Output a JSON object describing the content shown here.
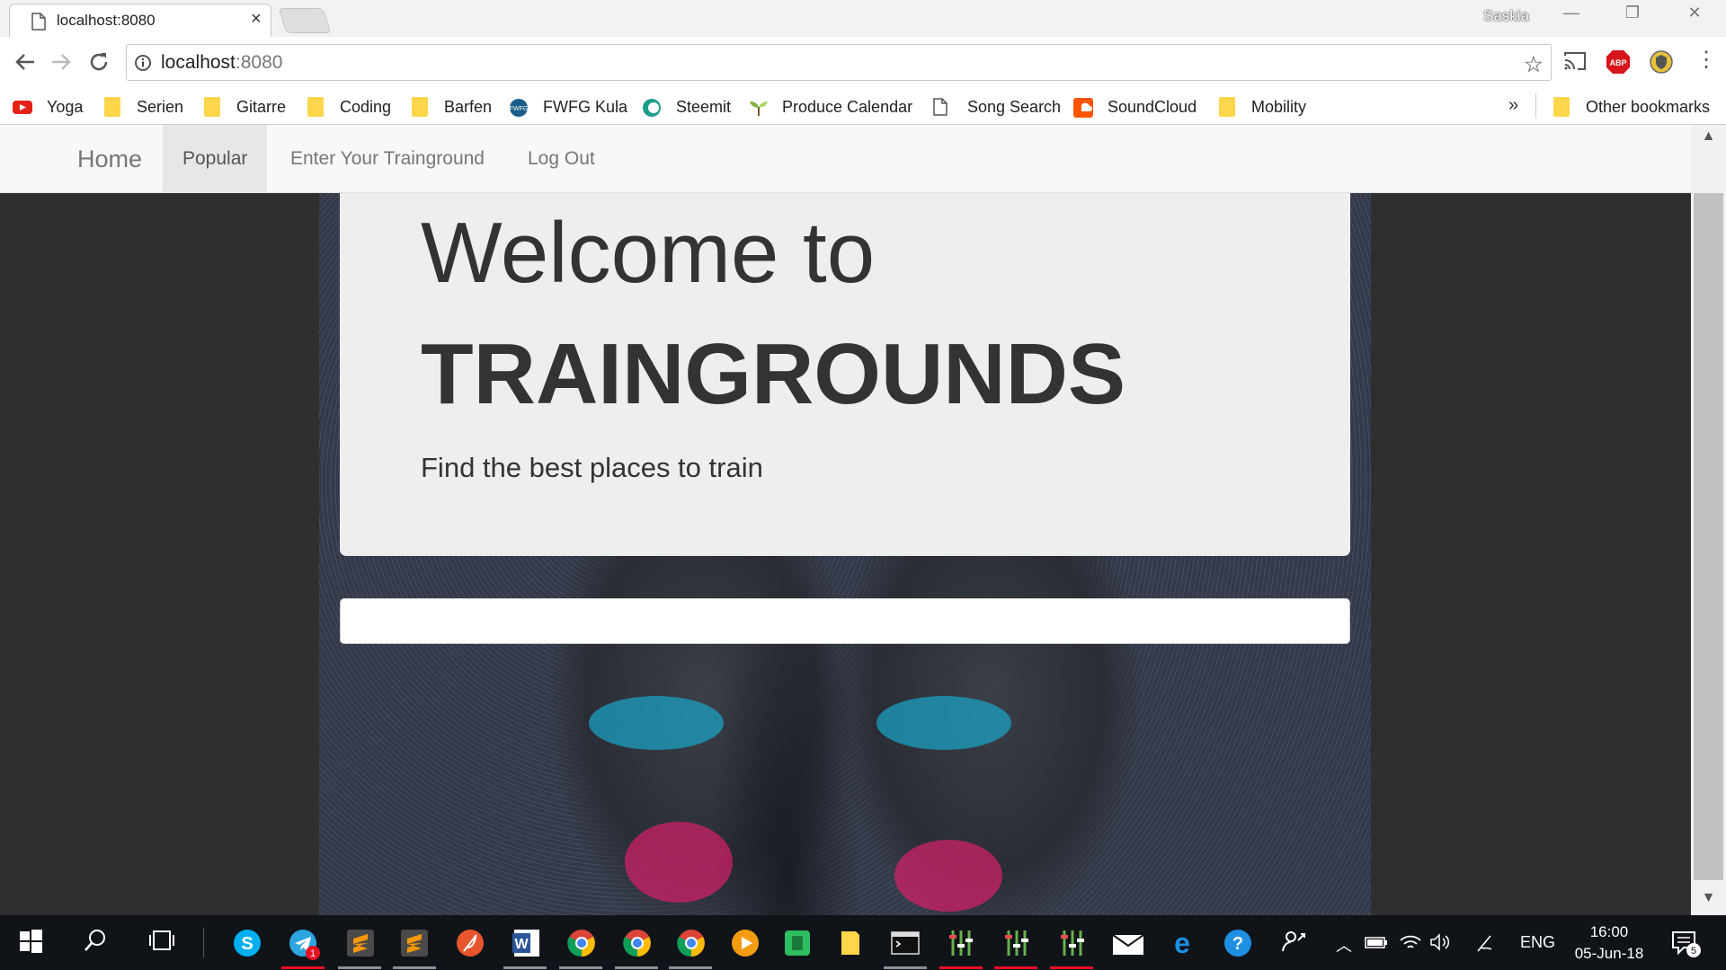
{
  "browser": {
    "tab_title": "localhost:8080",
    "tab_close": "×",
    "profile_name": "Saskia",
    "url_host": "localhost",
    "url_port": ":8080",
    "bookmarks": [
      {
        "label": "Yoga",
        "icon": "youtube-icon"
      },
      {
        "label": "Serien",
        "icon": "folder-icon"
      },
      {
        "label": "Gitarre",
        "icon": "folder-icon"
      },
      {
        "label": "Coding",
        "icon": "folder-icon"
      },
      {
        "label": "Barfen",
        "icon": "folder-icon"
      },
      {
        "label": "FWFG Kula",
        "icon": "fwfg-icon"
      },
      {
        "label": "Steemit",
        "icon": "steemit-icon"
      },
      {
        "label": "Produce Calendar",
        "icon": "sprout-icon"
      },
      {
        "label": "Song Search",
        "icon": "page-icon"
      },
      {
        "label": "SoundCloud",
        "icon": "soundcloud-icon"
      },
      {
        "label": "Mobility",
        "icon": "folder-icon"
      }
    ],
    "more_bookmarks": "»",
    "other_bookmarks": "Other bookmarks"
  },
  "site": {
    "nav": {
      "brand": "Home",
      "items": [
        "Popular",
        "Enter Your Trainground",
        "Log Out"
      ]
    },
    "hero": {
      "welcome": "Welcome to",
      "brand": "TRAINGROUNDS",
      "tagline": "Find the best places to train"
    },
    "search": {
      "value": "",
      "placeholder": ""
    }
  },
  "taskbar": {
    "language": "ENG",
    "time": "16:00",
    "date": "05-Jun-18",
    "notifications": "5",
    "telegram_badge": "1"
  },
  "colors": {
    "navbar_bg": "#f8f8f8",
    "jumbotron_bg": "#eeeeee",
    "page_bg": "#2f2f2f",
    "taskbar_bg": "#101419"
  }
}
